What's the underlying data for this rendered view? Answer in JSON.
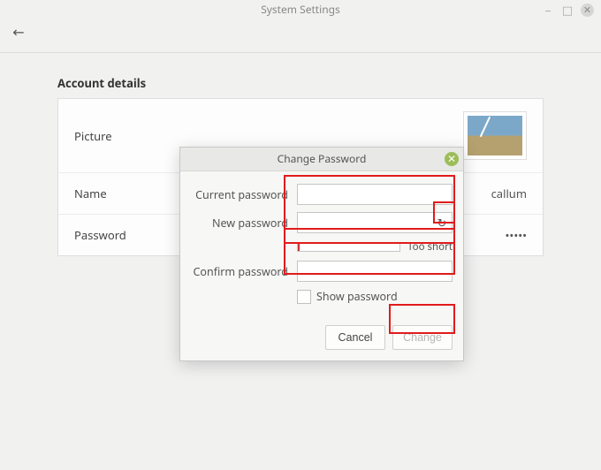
{
  "window": {
    "title": "System Settings"
  },
  "section": {
    "title": "Account details",
    "rows": {
      "picture_label": "Picture",
      "name_label": "Name",
      "name_value": "callum",
      "password_label": "Password",
      "password_value": "•••••"
    }
  },
  "dialog": {
    "title": "Change Password",
    "current_label": "Current password",
    "new_label": "New password",
    "confirm_label": "Confirm password",
    "strength_text": "Too short",
    "show_password_label": "Show password",
    "cancel_label": "Cancel",
    "change_label": "Change",
    "current_value": "",
    "new_value": "",
    "confirm_value": ""
  }
}
